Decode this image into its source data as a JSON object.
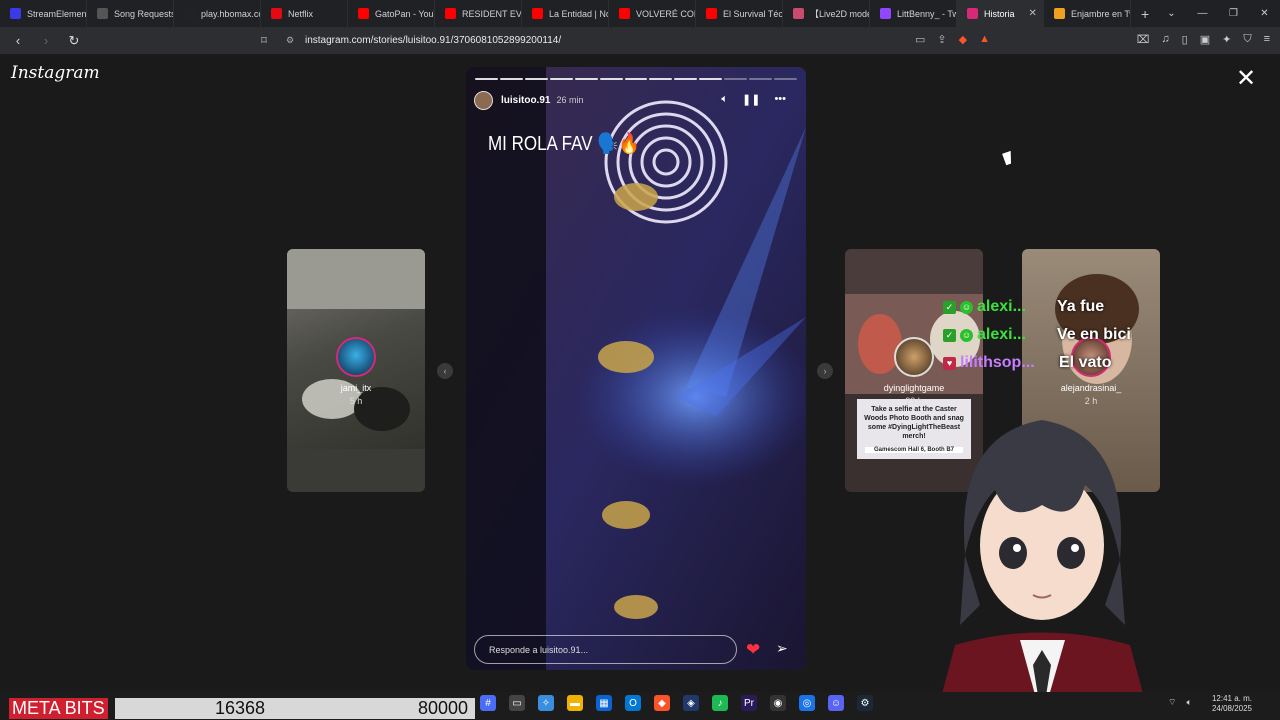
{
  "browser": {
    "tabs": [
      {
        "label": "StreamElement",
        "icon": "streamelements-icon",
        "color": "#3a3ae8"
      },
      {
        "label": "Song Requests",
        "icon": "gear-icon",
        "color": "#555"
      },
      {
        "label": "play.hbomax.co",
        "icon": "hbomax-icon",
        "color": "#222"
      },
      {
        "label": "Netflix",
        "icon": "netflix-icon",
        "color": "#e50914"
      },
      {
        "label": "GatoPan - YouT",
        "icon": "youtube-icon",
        "color": "#ff0000"
      },
      {
        "label": "RESIDENT EVIL",
        "icon": "youtube-icon",
        "color": "#ff0000"
      },
      {
        "label": "La Entidad | No",
        "icon": "youtube-icon",
        "color": "#ff0000"
      },
      {
        "label": "VOLVERÉ CON",
        "icon": "youtube-icon",
        "color": "#ff0000"
      },
      {
        "label": "El Survival Técn",
        "icon": "youtube-icon",
        "color": "#ff0000"
      },
      {
        "label": "【Live2D model",
        "icon": "live2d-icon",
        "color": "#c94b6d"
      },
      {
        "label": "LittBenny_ - Tw",
        "icon": "twitch-icon",
        "color": "#9146ff"
      },
      {
        "label": "Historia",
        "icon": "instagram-icon",
        "color": "#d62976",
        "active": true
      },
      {
        "label": "Enjambre en Tw",
        "icon": "crown-icon",
        "color": "#f0a020"
      }
    ],
    "new_tab": "+",
    "url": "instagram.com/stories/luisitoo.91/3706081052899200114/"
  },
  "instagram": {
    "logo": "Instagram",
    "close": "✕",
    "prev_story": {
      "username": "jami_itx",
      "time": "5 h"
    },
    "story": {
      "username": "luisitoo.91",
      "time": "26 min",
      "caption": "MI ROLA FAV",
      "caption_emoji": "🗣️🔥",
      "reply_placeholder": "Responde a luisitoo.91...",
      "progress_segments": 13,
      "progress_done": 10
    },
    "next_stories": [
      {
        "username": "dyinglightgame",
        "time": "23 h",
        "promo": "Take a selfie at the Caster Woods Photo Booth and snag some #DyingLightTheBeast merch!",
        "location": "Gamescom Hall 6, Booth B7"
      },
      {
        "username": "alejandrasinai_",
        "time": "2 h"
      }
    ]
  },
  "chat": [
    {
      "user": "alexi...",
      "message": "Ya fue",
      "color": "#3ce23c"
    },
    {
      "user": "alexi...",
      "message": "Ve en bici",
      "color": "#3ce23c"
    },
    {
      "user": "lilithsop...",
      "message": "El vato",
      "color": "#c77dff"
    }
  ],
  "overlay": {
    "meta_label": "META BITS",
    "count": "16368",
    "goal": "80000"
  },
  "system": {
    "time": "12:41 a. m.",
    "date": "24/08/2025"
  }
}
